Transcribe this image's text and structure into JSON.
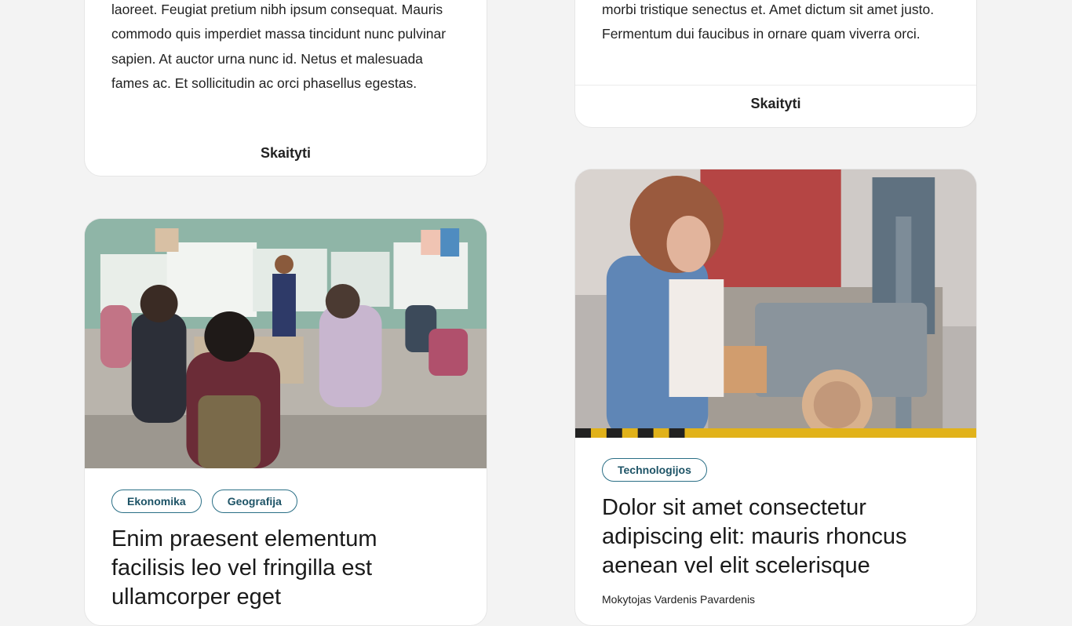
{
  "cards": [
    {
      "excerpt": "laoreet. Feugiat pretium nibh ipsum consequat. Mauris commodo quis imperdiet massa tincidunt nunc pulvinar sapien. At auctor urna nunc id. Netus et malesuada fames ac. Et sollicitudin ac orci phasellus egestas.",
      "read_more": "Skaityti"
    },
    {
      "excerpt": "morbi tristique senectus et. Amet dictum sit amet justo. Fermentum dui faucibus in ornare quam viverra orci.",
      "read_more": "Skaityti"
    },
    {
      "image_alt": "Classroom with students seated at tables facing a teacher at the whiteboard",
      "tags": [
        "Ekonomika",
        "Geografija"
      ],
      "title": "Enim praesent elementum facilisis leo vel fringilla est ullamcorper eget"
    },
    {
      "image_alt": "Student wearing safety glasses using a belt sander in a workshop",
      "tags": [
        "Technologijos"
      ],
      "title": "Dolor sit amet consectetur adipiscing elit: mauris rhoncus aenean vel elit scelerisque",
      "author": "Mokytojas Vardenis Pavardenis"
    }
  ],
  "colors": {
    "background": "#f3f3f3",
    "card": "#ffffff",
    "tag_border": "#2a6f86"
  }
}
